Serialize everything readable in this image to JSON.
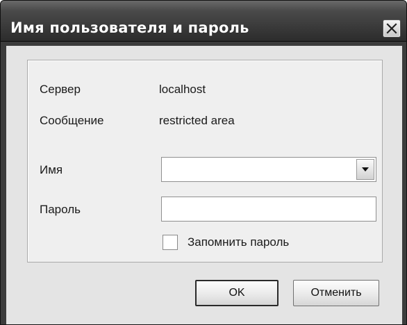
{
  "window": {
    "title": "Имя пользователя и пароль"
  },
  "info": {
    "server_label": "Сервер",
    "server_value": "localhost",
    "message_label": "Сообщение",
    "message_value": "restricted area"
  },
  "form": {
    "name_label": "Имя",
    "name_value": "",
    "password_label": "Пароль",
    "password_value": "",
    "remember_label": "Запомнить пароль",
    "remember_checked": false
  },
  "buttons": {
    "ok_label": "OK",
    "cancel_label": "Отменить"
  },
  "icons": {
    "close": "close-icon",
    "dropdown": "chevron-down-icon"
  },
  "colors": {
    "title_bar": "#2c2c2c",
    "frame": "#3c3c3c",
    "client_bg": "#e4e4e4",
    "group_bg": "#efefef"
  }
}
